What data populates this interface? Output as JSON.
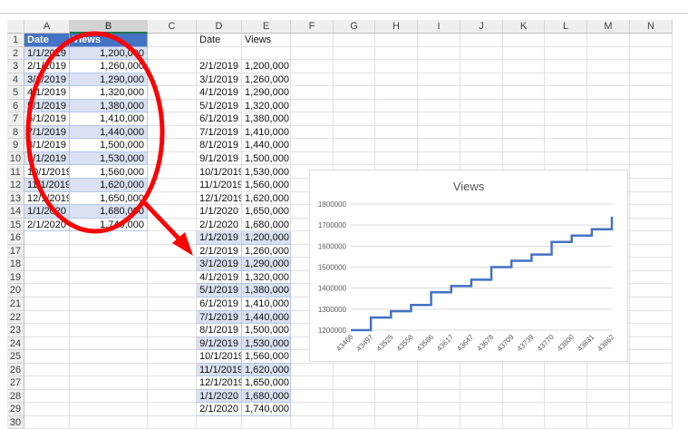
{
  "columns": [
    "A",
    "B",
    "C",
    "D",
    "E",
    "F",
    "G",
    "H",
    "I",
    "J",
    "K",
    "L",
    "M",
    "N"
  ],
  "rows": [
    [
      "Date",
      "Views",
      "",
      "Date",
      "Views"
    ],
    [
      "1/1/2019",
      "1,200,000",
      "",
      "",
      ""
    ],
    [
      "2/1/2019",
      "1,260,000",
      "",
      "2/1/2019",
      "1,200,000"
    ],
    [
      "3/1/2019",
      "1,290,000",
      "",
      "3/1/2019",
      "1,260,000"
    ],
    [
      "4/1/2019",
      "1,320,000",
      "",
      "4/1/2019",
      "1,290,000"
    ],
    [
      "5/1/2019",
      "1,380,000",
      "",
      "5/1/2019",
      "1,320,000"
    ],
    [
      "6/1/2019",
      "1,410,000",
      "",
      "6/1/2019",
      "1,380,000"
    ],
    [
      "7/1/2019",
      "1,440,000",
      "",
      "7/1/2019",
      "1,410,000"
    ],
    [
      "8/1/2019",
      "1,500,000",
      "",
      "8/1/2019",
      "1,440,000"
    ],
    [
      "9/1/2019",
      "1,530,000",
      "",
      "9/1/2019",
      "1,500,000"
    ],
    [
      "10/1/2019",
      "1,560,000",
      "",
      "10/1/2019",
      "1,530,000"
    ],
    [
      "11/1/2019",
      "1,620,000",
      "",
      "11/1/2019",
      "1,560,000"
    ],
    [
      "12/1/2019",
      "1,650,000",
      "",
      "12/1/2019",
      "1,620,000"
    ],
    [
      "1/1/2020",
      "1,680,000",
      "",
      "1/1/2020",
      "1,650,000"
    ],
    [
      "2/1/2020",
      "1,740,000",
      "",
      "2/1/2020",
      "1,680,000"
    ],
    [
      "",
      "",
      "",
      "1/1/2019",
      "1,200,000"
    ],
    [
      "",
      "",
      "",
      "2/1/2019",
      "1,260,000"
    ],
    [
      "",
      "",
      "",
      "3/1/2019",
      "1,290,000"
    ],
    [
      "",
      "",
      "",
      "4/1/2019",
      "1,320,000"
    ],
    [
      "",
      "",
      "",
      "5/1/2019",
      "1,380,000"
    ],
    [
      "",
      "",
      "",
      "6/1/2019",
      "1,410,000"
    ],
    [
      "",
      "",
      "",
      "7/1/2019",
      "1,440,000"
    ],
    [
      "",
      "",
      "",
      "8/1/2019",
      "1,500,000"
    ],
    [
      "",
      "",
      "",
      "9/1/2019",
      "1,530,000"
    ],
    [
      "",
      "",
      "",
      "10/1/2019",
      "1,560,000"
    ],
    [
      "",
      "",
      "",
      "11/1/2019",
      "1,620,000"
    ],
    [
      "",
      "",
      "",
      "12/1/2019",
      "1,650,000"
    ],
    [
      "",
      "",
      "",
      "1/1/2020",
      "1,680,000"
    ],
    [
      "",
      "",
      "",
      "2/1/2020",
      "1,740,000"
    ],
    [
      "",
      "",
      "",
      "",
      ""
    ]
  ],
  "colors": {
    "table_header": "#4472c4",
    "band": "#d9e1f2",
    "line": "#4472c4",
    "annotation": "#ff0000"
  },
  "chart_data": {
    "type": "line",
    "title": "Views",
    "style": "step",
    "x": [
      43466,
      43497,
      43525,
      43556,
      43586,
      43617,
      43647,
      43678,
      43709,
      43739,
      43770,
      43800,
      43831,
      43862
    ],
    "series": [
      {
        "name": "Views",
        "values": [
          1200000,
          1260000,
          1290000,
          1320000,
          1380000,
          1410000,
          1440000,
          1500000,
          1530000,
          1560000,
          1620000,
          1650000,
          1680000,
          1740000
        ]
      }
    ],
    "yticks": [
      1200000,
      1300000,
      1400000,
      1500000,
      1600000,
      1700000,
      1800000
    ],
    "ylim": [
      1200000,
      1800000
    ],
    "grid": true,
    "legend": "none"
  }
}
